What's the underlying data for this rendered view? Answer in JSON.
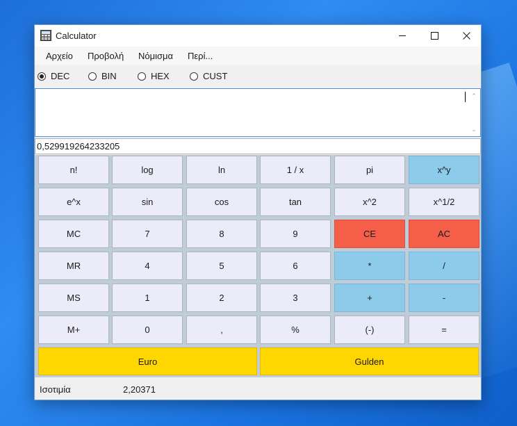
{
  "window": {
    "title": "Calculator"
  },
  "menu": {
    "items": [
      "Αρχείο",
      "Προβολή",
      "Νόμισμα",
      "Περί..."
    ]
  },
  "modes": {
    "options": [
      "DEC",
      "BIN",
      "HEX",
      "CUST"
    ],
    "selected": "DEC"
  },
  "input": {
    "text": ""
  },
  "display": {
    "value": "0,529919264233205"
  },
  "keys": {
    "rows": [
      [
        "n!",
        "log",
        "ln",
        "1 / x",
        "pi",
        "x^y"
      ],
      [
        "e^x",
        "sin",
        "cos",
        "tan",
        "x^2",
        "x^1/2"
      ],
      [
        "MC",
        "7",
        "8",
        "9",
        "CE",
        "AC"
      ],
      [
        "MR",
        "4",
        "5",
        "6",
        "*",
        "/"
      ],
      [
        "MS",
        "1",
        "2",
        "3",
        "+",
        "-"
      ],
      [
        "M+",
        "0",
        ",",
        "%",
        "(-)",
        "="
      ]
    ],
    "currency": [
      "Euro",
      "Gulden"
    ]
  },
  "colors": {
    "default_key": "#ebebfa",
    "blue_key": "#8ccbea",
    "red_key": "#f55f4a",
    "yellow_key": "#fed600"
  },
  "status": {
    "label": "Ισοτιμία",
    "value": "2,20371"
  }
}
